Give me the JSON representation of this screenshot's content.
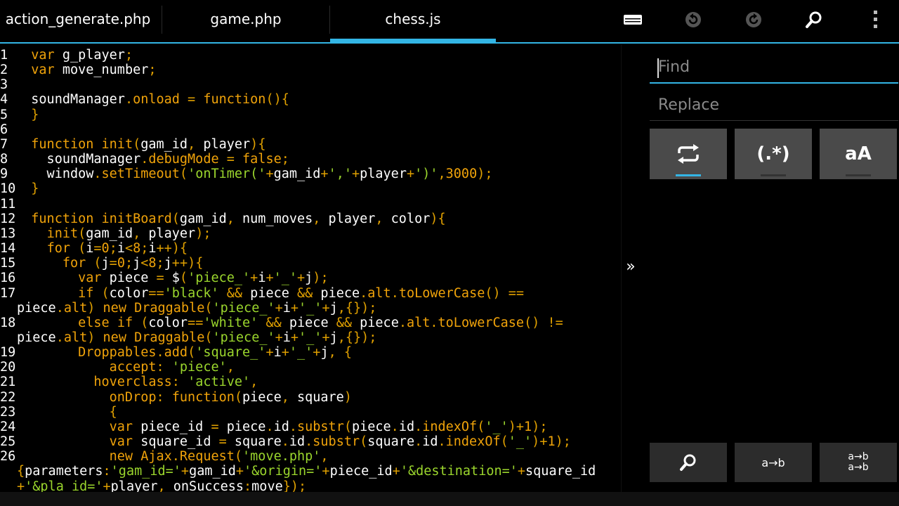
{
  "tabs": [
    {
      "label": "action_generate.php",
      "active": false
    },
    {
      "label": "game.php",
      "active": false
    },
    {
      "label": "chess.js",
      "active": true
    }
  ],
  "toolbar": {
    "icons": [
      "keyboard-icon",
      "undo-icon",
      "redo-icon",
      "search-icon",
      "overflow-menu-icon"
    ]
  },
  "colors": {
    "accent": "#33b5e5",
    "keyword": "#f0a30a",
    "string": "#9bd62d",
    "text": "#ffffff"
  },
  "editor": {
    "lines": [
      {
        "n": "1",
        "text": "  var g_player;"
      },
      {
        "n": "2",
        "text": "  var move_number;"
      },
      {
        "n": "3",
        "text": ""
      },
      {
        "n": "4",
        "text": "  soundManager.onload = function(){"
      },
      {
        "n": "5",
        "text": "  }"
      },
      {
        "n": "6",
        "text": ""
      },
      {
        "n": "7",
        "text": "  function init(gam_id, player){"
      },
      {
        "n": "8",
        "text": "    soundManager.debugMode = false;"
      },
      {
        "n": "9",
        "text": "    window.setTimeout('onTimer('+gam_id+','+player+')',3000);"
      },
      {
        "n": "10",
        "text": "  }"
      },
      {
        "n": "11",
        "text": ""
      },
      {
        "n": "12",
        "text": "  function initBoard(gam_id, num_moves, player, color){"
      },
      {
        "n": "13",
        "text": "    init(gam_id, player);"
      },
      {
        "n": "14",
        "text": "    for (i=0;i<8;i++){"
      },
      {
        "n": "15",
        "text": "      for (j=0;j<8;j++){"
      },
      {
        "n": "16",
        "text": "        var piece = $('piece_'+i+'_'+j);"
      },
      {
        "n": "17",
        "text": "        if (color=='black' && piece && piece.alt.toLowerCase() =="
      },
      {
        "n": "",
        "text": "piece.alt) new Draggable('piece_'+i+'_'+j,{});"
      },
      {
        "n": "18",
        "text": "        else if (color=='white' && piece && piece.alt.toLowerCase() !="
      },
      {
        "n": "",
        "text": "piece.alt) new Draggable('piece_'+i+'_'+j,{});"
      },
      {
        "n": "19",
        "text": "        Droppables.add('square_'+i+'_'+j, {"
      },
      {
        "n": "20",
        "text": "            accept: 'piece',"
      },
      {
        "n": "21",
        "text": "          hoverclass: 'active',"
      },
      {
        "n": "22",
        "text": "            onDrop: function(piece, square)"
      },
      {
        "n": "23",
        "text": "            {"
      },
      {
        "n": "24",
        "text": "            var piece_id = piece.id.substr(piece.id.indexOf('_')+1);"
      },
      {
        "n": "25",
        "text": "            var square_id = square.id.substr(square.id.indexOf('_')+1);"
      },
      {
        "n": "26",
        "text": "            new Ajax.Request('move.php',"
      },
      {
        "n": "",
        "text": "{parameters:'gam_id='+gam_id+'&origin='+piece_id+'&destination='+square_id"
      },
      {
        "n": "",
        "text": "+'&pla_id='+player, onSuccess:move});"
      }
    ]
  },
  "find_panel": {
    "find_placeholder": "Find",
    "replace_placeholder": "Replace",
    "options": [
      {
        "name": "replace-all-toggle",
        "label": "",
        "icon": "repeat-icon",
        "active": true
      },
      {
        "name": "regex-toggle",
        "label": "(.*)",
        "active": false
      },
      {
        "name": "match-case-toggle",
        "label": "aA",
        "active": false
      }
    ],
    "actions": [
      {
        "name": "find-button",
        "icon": "search-icon",
        "label": ""
      },
      {
        "name": "replace-button",
        "label": "a→b"
      },
      {
        "name": "replace-all-button",
        "label_line1": "a→b",
        "label_line2": "a→b"
      }
    ],
    "collapse_label": "»"
  }
}
